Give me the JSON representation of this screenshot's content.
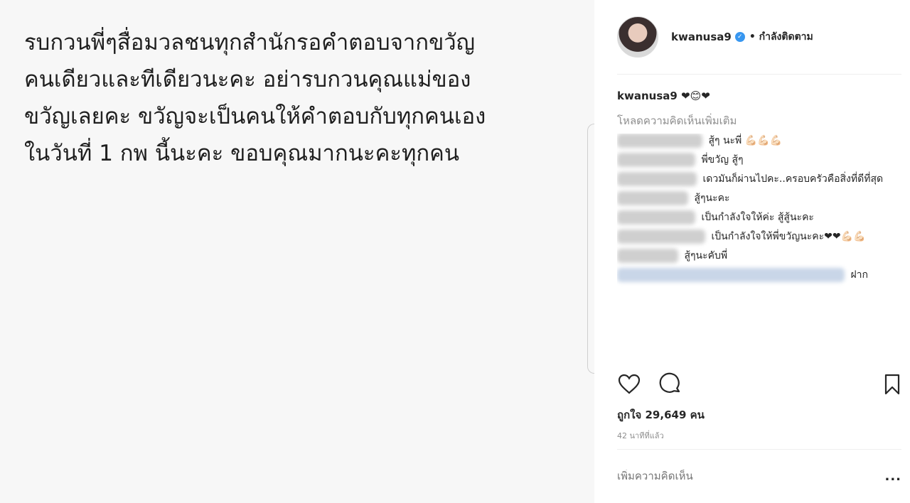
{
  "post": {
    "image_text": "รบกวนพี่ๆสื่อมวลชนทุกสำนักรอคำตอบจากขวัญ\nคนเดียวและทีเดียวนะคะ อย่ารบกวนคุณแม่ของ\nขวัญเลยคะ ขวัญจะเป็นคนให้คำตอบกับทุกคนเอง\nในวันที่ 1 กพ นี้นะคะ ขอบคุณมากนะคะทุกคน"
  },
  "header": {
    "username": "kwanusa9",
    "follow_state": "• กำลังติดตาม"
  },
  "caption": "kwanusa9 ❤😊❤",
  "load_more": "โหลดความคิดเห็นเพิ่มเติม",
  "comments": [
    {
      "text": "สู้ๆ นะพี่ 💪🏻💪🏻💪🏻"
    },
    {
      "text": "พี่ขวัญ สู้ๆ"
    },
    {
      "text": "เดวมันก็ผ่านไปคะ..ครอบครัวคือสิ่งที่ดีที่สุด"
    },
    {
      "text": "สู้ๆนะคะ"
    },
    {
      "text": "เป็นกำลังใจให้ค่ะ สู้สู้นะคะ"
    },
    {
      "text": "เป็นกำลังใจให้พี่ขวัญนะคะ❤❤💪🏻💪🏻"
    },
    {
      "text": "สู้ๆนะคับพี่"
    },
    {
      "text": "ฝาก"
    }
  ],
  "likes": "ถูกใจ 29,649 คน",
  "time": "42 นาทีที่แล้ว",
  "add_comment_placeholder": "เพิ่มความคิดเห็น",
  "more_label": "...",
  "colors": {
    "accent": "#3897f0",
    "muted": "#8e8e8e",
    "text": "#262626"
  },
  "icons": [
    "heart-icon",
    "comment-icon",
    "bookmark-icon",
    "verified-badge-icon"
  ]
}
